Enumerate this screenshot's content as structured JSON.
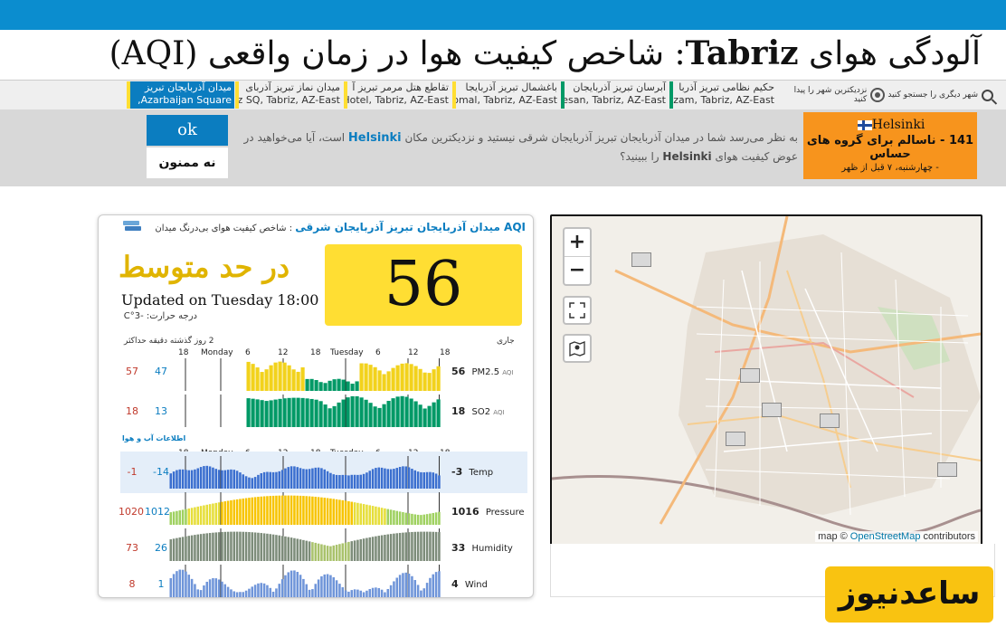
{
  "page": {
    "title_part1": "آلودگی هوای",
    "title_city": "Tabriz",
    "title_part2": ": شاخص کیفیت هوا در زمان واقعی (AQI)"
  },
  "stations_bar": {
    "search_label": "شهر دیگری را جستجو کنید",
    "nearest_label": "نزدیکترین شهر را پیدا کنید",
    "items": [
      {
        "name": "حکیم نظامی تبریز آذربا",
        "addr": "Nezam, Tabriz, AZ-East"
      },
      {
        "name": "آبرسان تبریز آذربایجان",
        "addr": "oresan, Tabriz, AZ-East"
      },
      {
        "name": "باغشمال تبریز آذربایجا",
        "addr": "shomal, Tabriz, AZ-East"
      },
      {
        "name": "تقاطع هتل مرمر تبریز آ",
        "addr": "Hotel, Tabriz, AZ-East"
      },
      {
        "name": "میدان نماز تبریز آذربای",
        "addr": "maz SQ, Tabriz, AZ-East"
      },
      {
        "name": "میدان آذربایجان تبریز",
        "addr": "Azarbaijan Square,"
      }
    ]
  },
  "suggestion": {
    "ok_label": "ok",
    "no_label": "نه ممنون",
    "text_part1": "به نظر می‌رسد شما در میدان آذربایجان تبریز آذربایجان شرقی نیستید و نزدیکترین مکان",
    "text_city": "Helsinki",
    "text_part2": "است، آیا می‌خواهید در عوض کیفیت هوای",
    "text_city2": "Helsinki",
    "text_part3": "را ببینید؟",
    "box_city": "Helsinki",
    "box_aqi": "141 - ناسالم برای گروه های حساس",
    "box_when": "- چهارشنبه، ۷ قبل از ظهر"
  },
  "card": {
    "header_link": "AQI میدان آذربایجان تبریز آذربایجان شرقی",
    "header_text": ": شاخص کیفیت هوای بی‌درنگ میدان",
    "aqi_value": "56",
    "level": "در حد متوسط",
    "updated": "Updated on Tuesday 18:00",
    "temp_label": "درجه حرارت:",
    "temp_value": "-3°C",
    "col_current": "جاری",
    "col_history": "2 روز گذشته",
    "col_min": "دقیقه",
    "col_max": "حداکثر",
    "weather_header": "اطلاعات آب و هوا",
    "ticks": [
      "18",
      "Monday",
      "6",
      "12",
      "18",
      "Tuesday",
      "6",
      "12",
      "18"
    ],
    "rows": [
      {
        "label": "PM2.5",
        "unit": "AQI",
        "current": "56",
        "min": "47",
        "max": "57"
      },
      {
        "label": "SO2",
        "unit": "AQI",
        "current": "18",
        "min": "13",
        "max": "18"
      },
      {
        "label": "Temp",
        "unit": "",
        "current": "-3",
        "min": "-14",
        "max": "-1"
      },
      {
        "label": "Pressure",
        "unit": "",
        "current": "1016",
        "min": "1012",
        "max": "1020"
      },
      {
        "label": "Humidity",
        "unit": "",
        "current": "33",
        "min": "26",
        "max": "73"
      },
      {
        "label": "Wind",
        "unit": "",
        "current": "4",
        "min": "1",
        "max": "8"
      }
    ]
  },
  "map": {
    "zoom_in": "+",
    "zoom_out": "−",
    "attribution_prefix": "map ©",
    "attribution_link": "OpenStreetMap",
    "attribution_suffix": "contributors"
  },
  "watermark": "ساعدنیوز",
  "colors": {
    "accent": "#0b8dcf",
    "aqi_moderate": "#ffde33",
    "aqi_good": "#009966",
    "orange": "#f7941d"
  }
}
